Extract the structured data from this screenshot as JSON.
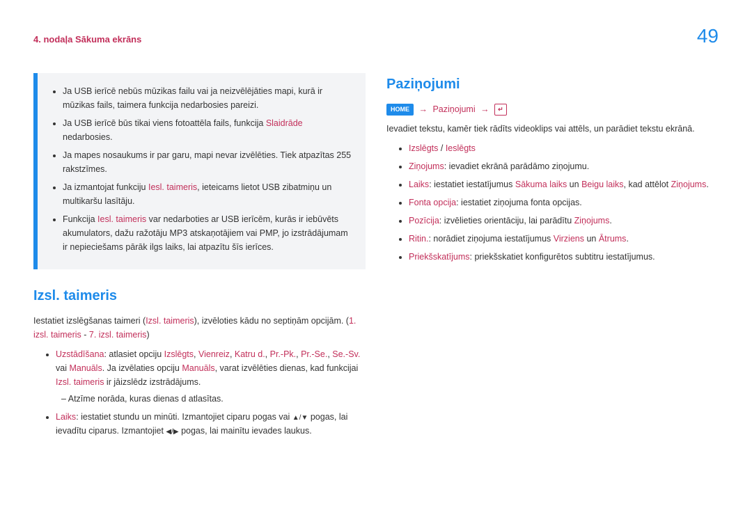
{
  "page": {
    "chapter": "4. nodaļa Sākuma ekrāns",
    "number": "49"
  },
  "leftCol": {
    "box": {
      "li1": "Ja USB ierīcē nebūs mūzikas failu vai ja neizvēlējāties mapi, kurā ir mūzikas fails, taimera funkcija nedarbosies pareizi.",
      "li2a": "Ja USB ierīcē būs tikai viens fotoattēla fails, funkcija ",
      "li2b": "Slaidrāde",
      "li2c": " nedarbosies.",
      "li3": "Ja mapes nosaukums ir par garu, mapi nevar izvēlēties. Tiek atpazītas 255 rakstzīmes.",
      "li4a": "Ja izmantojat funkciju ",
      "li4b": "Iesl. taimeris",
      "li4c": ", ieteicams lietot USB zibatmiņu un multikaršu lasītāju.",
      "li5a": "Funkcija ",
      "li5b": "Iesl. taimeris",
      "li5c": " var nedarboties ar USB ierīcēm, kurās ir iebūvēts akumulators, dažu ražotāju MP3 atskaņotājiem vai PMP, jo izstrādājumam ir nepieciešams pārāk ilgs laiks, lai atpazītu šīs ierīces."
    },
    "h2": "Izsl. taimeris",
    "p1a": "Iestatiet izslēgšanas taimeri (",
    "p1b": "Izsl. taimeris",
    "p1c": "), izvēloties kādu no septiņām opcijām. (",
    "p1d": "1. izsl. taimeris",
    "p1e": " - ",
    "p1f": "7. izsl. taimeris",
    "p1g": ")",
    "li6": {
      "a": "Uzstādīšana",
      "b": ": atlasiet opciju ",
      "c": "Izslēgts",
      "d": ", ",
      "e": "Vienreiz",
      "f": ", ",
      "g": "Katru d.",
      "h": ", ",
      "i": "Pr.-Pk.",
      "j": ", ",
      "k": "Pr.-Se.",
      "l": ", ",
      "m": "Se.-Sv.",
      "n": " vai ",
      "o": "Manuāls",
      "p": ". Ja izvēlaties opciju ",
      "q": "Manuāls",
      "r": ", varat izvēlēties dienas, kad funkcijai ",
      "s": "Izsl. taimeris",
      "t": " ir jāizslēdz izstrādājums."
    },
    "li6sub": "Atzīme norāda, kuras dienas d atlasītas.",
    "li7": {
      "a": "Laiks",
      "b": ": iestatiet stundu un minūti. Izmantojiet ciparu pogas vai ",
      "c": " pogas, lai ievadītu ciparus. Izmantojiet ",
      "d": " pogas, lai mainītu ievades laukus."
    }
  },
  "rightCol": {
    "h2": "Paziņojumi",
    "nav": {
      "home": "HOME",
      "path": "Paziņojumi",
      "enter": "↵"
    },
    "intro": "Ievadiet tekstu, kamēr tiek rādīts videoklips vai attēls, un parādiet tekstu ekrānā.",
    "r1": {
      "a": "Izslēgts",
      "b": " / ",
      "c": "Ieslēgts"
    },
    "r2": {
      "a": "Ziņojums",
      "b": ": ievadiet ekrānā parādāmo ziņojumu."
    },
    "r3": {
      "a": "Laiks",
      "b": ": iestatiet iestatījumus ",
      "c": "Sākuma laiks",
      "d": " un ",
      "e": "Beigu laiks",
      "f": ", kad attēlot ",
      "g": "Ziņojums",
      "h": "."
    },
    "r4": {
      "a": "Fonta opcija",
      "b": ": iestatiet ziņojuma fonta opcijas."
    },
    "r5": {
      "a": "Pozīcija",
      "b": ": izvēlieties orientāciju, lai parādītu ",
      "c": "Ziņojums",
      "d": "."
    },
    "r6": {
      "a": "Ritin.",
      "b": ": norādiet ziņojuma iestatījumus ",
      "c": "Virziens",
      "d": " un ",
      "e": "Ātrums",
      "f": "."
    },
    "r7": {
      "a": "Priekšskatījums",
      "b": ": priekšskatiet konfigurētos subtitru iestatījumus."
    }
  }
}
